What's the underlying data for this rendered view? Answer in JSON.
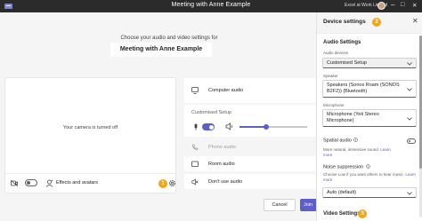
{
  "window": {
    "title": "Meeting with Anne Example",
    "org": "Excel at Work Limited",
    "app_icon": "teams-icon",
    "controls": {
      "minimize": "–",
      "maximize": "□",
      "close": "✕"
    }
  },
  "prejoin": {
    "prompt": "Choose your audio and video settings for",
    "meeting_title": "Meeting with Anne Example",
    "camera_off_text": "Your camera is turned off",
    "effects_label": "Effects and avatars",
    "callout_1": "1"
  },
  "audio_options": {
    "computer_audio": "Computer audio",
    "custom_setup": "Customised Setup",
    "phone_audio": "Phone audio",
    "room_audio": "Room audio",
    "dont_use_audio": "Don't use audio",
    "mic_volume": 0.4
  },
  "actions": {
    "cancel": "Cancel",
    "join": "Join"
  },
  "device_settings": {
    "title": "Device settings",
    "callout_2": "2",
    "close_glyph": "✕",
    "audio_section": "Audio Settings",
    "audio_devices_label": "Audio devices",
    "audio_devices_value": "Customised Setup",
    "speaker_label": "Speaker",
    "speaker_value": "Speakers (Sonos Roam (SONOS B2F2)) (Bluetooth)",
    "microphone_label": "Microphone",
    "microphone_value": "Microphone (Yeti Stereo Microphone)",
    "spatial_audio_title": "Spatial audio",
    "spatial_audio_desc": "More natural, immersive sound.",
    "learn_more": "Learn more",
    "noise_title": "Noise suppression",
    "noise_desc": "Choose Low if you want others to hear music.",
    "noise_value": "Auto (default)",
    "video_section": "Video Settings",
    "callout_3": "3"
  },
  "colors": {
    "accent": "#5b5fc7",
    "callout": "#f2a51a",
    "titlebar": "#2b2b2b",
    "stage": "#f5f5f5"
  }
}
